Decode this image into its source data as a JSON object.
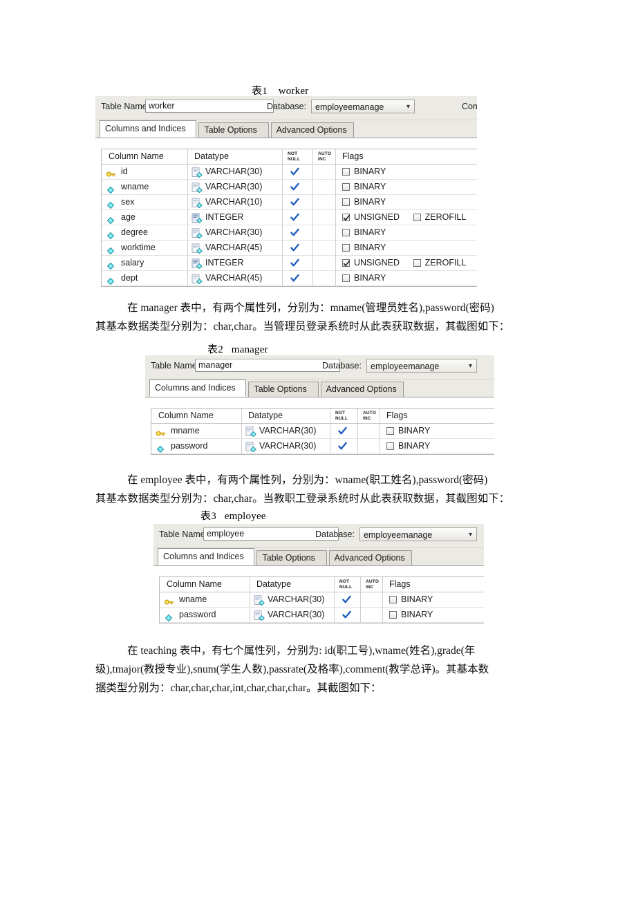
{
  "document": {
    "captions": {
      "table1": "表1    worker",
      "table2": "表2   manager",
      "table3": "表3   employee"
    },
    "paragraphs": {
      "p1_line1": "在 manager 表中，有两个属性列，分别为：mname(管理员姓名),password(密码)",
      "p1_line2": "其基本数据类型分别为：char,char。当管理员登录系统时从此表获取数据，其截图如下：",
      "p2_line1": "在 employee 表中，有两个属性列，分别为：wname(职工姓名),password(密码)",
      "p2_line2": "其基本数据类型分别为：char,char。当教职工登录系统时从此表获取数据，其截图如下：",
      "p3_line1": "在 teaching 表中，有七个属性列，分别为: id(职工号),wname(姓名),grade(年",
      "p3_line2": "级),tmajor(教授专业),snum(学生人数),passrate(及格率),comment(教学总评)。其基本数",
      "p3_line3": "据类型分别为：char,char,char,int,char,char,char。其截图如下："
    }
  },
  "panels": [
    {
      "id": "worker",
      "table_name_label": "Table Name:",
      "table_name_value": "worker",
      "database_label": "Database:",
      "database_value": "employeemanage",
      "extra_label": "Com",
      "tabs": [
        {
          "label": "Columns and Indices",
          "active": true
        },
        {
          "label": "Table Options",
          "active": false
        },
        {
          "label": "Advanced Options",
          "active": false
        }
      ],
      "grid_headers": {
        "column_name": "Column Name",
        "datatype": "Datatype",
        "not_null_a": "NOT",
        "not_null_b": "NULL",
        "auto_inc_a": "AUTO",
        "auto_inc_b": "INC",
        "flags": "Flags"
      },
      "rows": [
        {
          "icon": "key-icon",
          "name": "id",
          "datatype": "VARCHAR(30)",
          "dt_icon": "char-type-icon",
          "not_null": true,
          "auto_inc": false,
          "flags": [
            {
              "label": "BINARY",
              "checked": false
            }
          ]
        },
        {
          "icon": "diamond-icon",
          "name": "wname",
          "datatype": "VARCHAR(30)",
          "dt_icon": "char-type-icon",
          "not_null": true,
          "auto_inc": false,
          "flags": [
            {
              "label": "BINARY",
              "checked": false
            }
          ]
        },
        {
          "icon": "diamond-icon",
          "name": "sex",
          "datatype": "VARCHAR(10)",
          "dt_icon": "char-type-icon",
          "not_null": true,
          "auto_inc": false,
          "flags": [
            {
              "label": "BINARY",
              "checked": false
            }
          ]
        },
        {
          "icon": "diamond-icon",
          "name": "age",
          "datatype": "INTEGER",
          "dt_icon": "int-type-icon",
          "not_null": true,
          "auto_inc": false,
          "flags": [
            {
              "label": "UNSIGNED",
              "checked": true
            },
            {
              "label": "ZEROFILL",
              "checked": false
            }
          ]
        },
        {
          "icon": "diamond-icon",
          "name": "degree",
          "datatype": "VARCHAR(30)",
          "dt_icon": "char-type-icon",
          "not_null": true,
          "auto_inc": false,
          "flags": [
            {
              "label": "BINARY",
              "checked": false
            }
          ]
        },
        {
          "icon": "diamond-icon",
          "name": "worktime",
          "datatype": "VARCHAR(45)",
          "dt_icon": "char-type-icon",
          "not_null": true,
          "auto_inc": false,
          "flags": [
            {
              "label": "BINARY",
              "checked": false
            }
          ]
        },
        {
          "icon": "diamond-icon",
          "name": "salary",
          "datatype": "INTEGER",
          "dt_icon": "int-type-icon",
          "not_null": true,
          "auto_inc": false,
          "flags": [
            {
              "label": "UNSIGNED",
              "checked": true
            },
            {
              "label": "ZEROFILL",
              "checked": false
            }
          ]
        },
        {
          "icon": "diamond-icon",
          "name": "dept",
          "datatype": "VARCHAR(45)",
          "dt_icon": "char-type-icon",
          "not_null": true,
          "auto_inc": false,
          "flags": [
            {
              "label": "BINARY",
              "checked": false
            }
          ]
        }
      ]
    },
    {
      "id": "manager",
      "table_name_label": "Table Name:",
      "table_name_value": "manager",
      "database_label": "Database:",
      "database_value": "employeemanage",
      "extra_label": "",
      "tabs": [
        {
          "label": "Columns and Indices",
          "active": true
        },
        {
          "label": "Table Options",
          "active": false
        },
        {
          "label": "Advanced Options",
          "active": false
        }
      ],
      "grid_headers": {
        "column_name": "Column Name",
        "datatype": "Datatype",
        "not_null_a": "NOT",
        "not_null_b": "NULL",
        "auto_inc_a": "AUTO",
        "auto_inc_b": "INC",
        "flags": "Flags"
      },
      "rows": [
        {
          "icon": "key-icon",
          "name": "mname",
          "datatype": "VARCHAR(30)",
          "dt_icon": "char-type-icon",
          "not_null": true,
          "auto_inc": false,
          "flags": [
            {
              "label": "BINARY",
              "checked": false
            }
          ]
        },
        {
          "icon": "diamond-icon",
          "name": "password",
          "datatype": "VARCHAR(30)",
          "dt_icon": "char-type-icon",
          "not_null": true,
          "auto_inc": false,
          "flags": [
            {
              "label": "BINARY",
              "checked": false
            }
          ]
        }
      ]
    },
    {
      "id": "employee",
      "table_name_label": "Table Name:",
      "table_name_value": "employee",
      "database_label": "Database:",
      "database_value": "employeemanage",
      "extra_label": "",
      "tabs": [
        {
          "label": "Columns and Indices",
          "active": true
        },
        {
          "label": "Table Options",
          "active": false
        },
        {
          "label": "Advanced Options",
          "active": false
        }
      ],
      "grid_headers": {
        "column_name": "Column Name",
        "datatype": "Datatype",
        "not_null_a": "NOT",
        "not_null_b": "NULL",
        "auto_inc_a": "AUTO",
        "auto_inc_b": "INC",
        "flags": "Flags"
      },
      "rows": [
        {
          "icon": "key-icon",
          "name": "wname",
          "datatype": "VARCHAR(30)",
          "dt_icon": "char-type-icon",
          "not_null": true,
          "auto_inc": false,
          "flags": [
            {
              "label": "BINARY",
              "checked": false
            }
          ]
        },
        {
          "icon": "diamond-icon",
          "name": "password",
          "datatype": "VARCHAR(30)",
          "dt_icon": "char-type-icon",
          "not_null": true,
          "auto_inc": false,
          "flags": [
            {
              "label": "BINARY",
              "checked": false
            }
          ]
        }
      ]
    }
  ],
  "colors": {
    "check_blue": "#1f5fbf",
    "key_yellow": "#f0c419",
    "diamond_cyan": "#3fd2e0",
    "panel_chrome": "#eceae4"
  }
}
